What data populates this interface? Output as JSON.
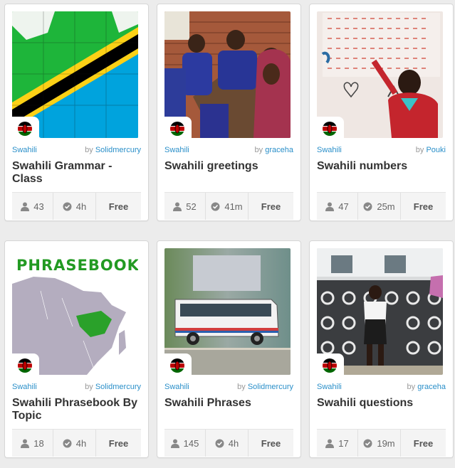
{
  "cards": [
    {
      "language": "Swahili",
      "by": "by",
      "author": "Solidmercury",
      "title": "Swahili Grammar - Class",
      "learners": "43",
      "duration": "4h",
      "price": "Free",
      "image": "tanzania-flag-puzzle",
      "flag_icon": "kenya-flag-icon"
    },
    {
      "language": "Swahili",
      "by": "by",
      "author": "graceha",
      "title": "Swahili greetings",
      "learners": "52",
      "duration": "41m",
      "price": "Free",
      "image": "classroom-children",
      "flag_icon": "kenya-flag-icon"
    },
    {
      "language": "Swahili",
      "by": "by",
      "author": "Pouki",
      "title": "Swahili numbers",
      "learners": "47",
      "duration": "25m",
      "price": "Free",
      "image": "child-at-number-chart",
      "flag_icon": "kenya-flag-icon"
    },
    {
      "language": "Swahili",
      "by": "by",
      "author": "Solidmercury",
      "title": "Swahili Phrasebook By Topic",
      "learners": "18",
      "duration": "4h",
      "price": "Free",
      "image": "phrasebook-map",
      "image_text": "PHRASEBOOK",
      "flag_icon": "kenya-flag-icon"
    },
    {
      "language": "Swahili",
      "by": "by",
      "author": "Solidmercury",
      "title": "Swahili Phrases",
      "learners": "145",
      "duration": "4h",
      "price": "Free",
      "image": "minibus",
      "flag_icon": "kenya-flag-icon"
    },
    {
      "language": "Swahili",
      "by": "by",
      "author": "graceha",
      "title": "Swahili questions",
      "learners": "17",
      "duration": "19m",
      "price": "Free",
      "image": "child-at-gate",
      "flag_icon": "kenya-flag-icon"
    }
  ],
  "colors": {
    "link": "#2a8fc9",
    "title": "#333333",
    "muted": "#999999",
    "background": "#ececec"
  }
}
